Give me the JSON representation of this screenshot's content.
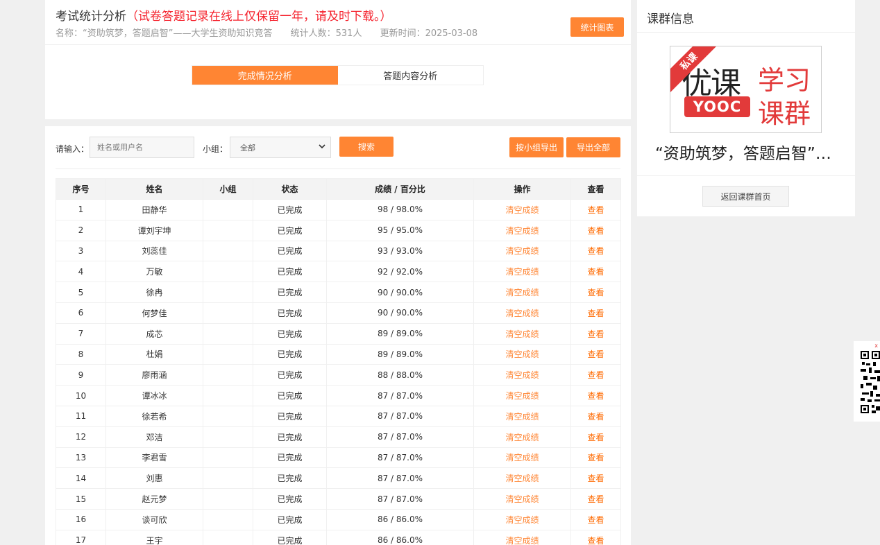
{
  "header": {
    "title": "考试统计分析",
    "warning": "（试卷答题记录在线上仅保留一年，请及时下载。）",
    "meta_name": "名称：“资助筑梦，答题启智”——大学生资助知识竞答",
    "meta_count": "统计人数：531人",
    "meta_updated": "更新时间：2025-03-08",
    "stat_chart_label": "统计图表"
  },
  "tabs": [
    {
      "label": "完成情况分析",
      "active": true
    },
    {
      "label": "答题内容分析",
      "active": false
    }
  ],
  "filters": {
    "input_label": "请输入：",
    "input_placeholder": "姓名或用户名",
    "group_label": "小组：",
    "group_selected": "全部",
    "search_label": "搜索",
    "export_group_label": "按小组导出",
    "export_all_label": "导出全部"
  },
  "table": {
    "columns": [
      "序号",
      "姓名",
      "小组",
      "状态",
      "成绩 / 百分比",
      "操作",
      "查看"
    ],
    "rows": [
      [
        "1",
        "田静华",
        "",
        "已完成",
        "98 / 98.0%",
        "清空成绩",
        "查看"
      ],
      [
        "2",
        "谭刘宇坤",
        "",
        "已完成",
        "95 / 95.0%",
        "清空成绩",
        "查看"
      ],
      [
        "3",
        "刘蕊佳",
        "",
        "已完成",
        "93 / 93.0%",
        "清空成绩",
        "查看"
      ],
      [
        "4",
        "万敏",
        "",
        "已完成",
        "92 / 92.0%",
        "清空成绩",
        "查看"
      ],
      [
        "5",
        "徐冉",
        "",
        "已完成",
        "90 / 90.0%",
        "清空成绩",
        "查看"
      ],
      [
        "6",
        "何梦佳",
        "",
        "已完成",
        "90 / 90.0%",
        "清空成绩",
        "查看"
      ],
      [
        "7",
        "成芯",
        "",
        "已完成",
        "89 / 89.0%",
        "清空成绩",
        "查看"
      ],
      [
        "8",
        "杜娟",
        "",
        "已完成",
        "89 / 89.0%",
        "清空成绩",
        "查看"
      ],
      [
        "9",
        "廖雨涵",
        "",
        "已完成",
        "88 / 88.0%",
        "清空成绩",
        "查看"
      ],
      [
        "10",
        "谭冰冰",
        "",
        "已完成",
        "87 / 87.0%",
        "清空成绩",
        "查看"
      ],
      [
        "11",
        "徐若希",
        "",
        "已完成",
        "87 / 87.0%",
        "清空成绩",
        "查看"
      ],
      [
        "12",
        "邓洁",
        "",
        "已完成",
        "87 / 87.0%",
        "清空成绩",
        "查看"
      ],
      [
        "13",
        "李君雪",
        "",
        "已完成",
        "87 / 87.0%",
        "清空成绩",
        "查看"
      ],
      [
        "14",
        "刘惠",
        "",
        "已完成",
        "87 / 87.0%",
        "清空成绩",
        "查看"
      ],
      [
        "15",
        "赵元梦",
        "",
        "已完成",
        "87 / 87.0%",
        "清空成绩",
        "查看"
      ],
      [
        "16",
        "谈可欣",
        "",
        "已完成",
        "86 / 86.0%",
        "清空成绩",
        "查看"
      ],
      [
        "17",
        "王宇",
        "",
        "已完成",
        "86 / 86.0%",
        "清空成绩",
        "查看"
      ]
    ]
  },
  "sidebar": {
    "title": "课群信息",
    "logo_ribbon": "私课",
    "logo_youke": "优课",
    "logo_yooc": "YOOC",
    "logo_xuexi": "学习",
    "logo_kequn": "课群",
    "course_name": "“资助筑梦，答题启智”——大学生资助知识竞答",
    "back_label": "返回课群首页"
  },
  "qr": {
    "close": "x"
  },
  "colors": {
    "accent": "#ff8533",
    "warning": "#f5222d",
    "brand_red": "#e23a3a"
  }
}
